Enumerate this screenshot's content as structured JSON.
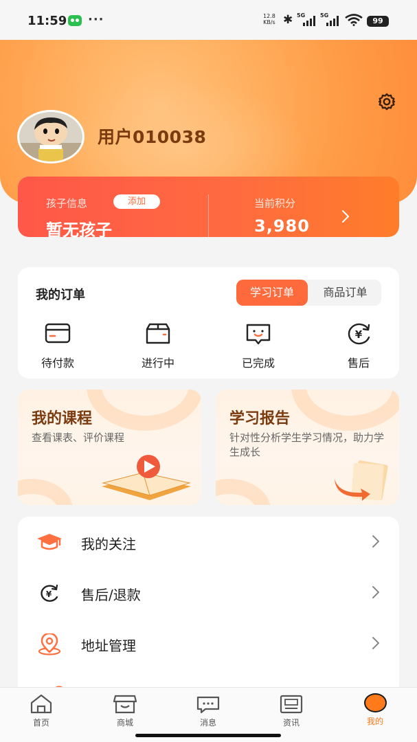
{
  "status_bar": {
    "time": "11:59",
    "dots": "···",
    "speed_value": "12.8",
    "speed_unit": "KB/s",
    "net1": "5G",
    "net2": "5G",
    "battery": "99"
  },
  "header": {
    "username": "用户010038"
  },
  "info_card": {
    "child_label": "孩子信息",
    "add_label": "添加",
    "child_value": "暂无孩子",
    "points_label": "当前积分",
    "points_value": "3,980"
  },
  "orders": {
    "title": "我的订单",
    "tabs": [
      {
        "label": "学习订单",
        "active": true
      },
      {
        "label": "商品订单",
        "active": false
      }
    ],
    "items": [
      {
        "label": "待付款",
        "icon": "wallet-icon"
      },
      {
        "label": "进行中",
        "icon": "package-icon"
      },
      {
        "label": "已完成",
        "icon": "smile-chat-icon"
      },
      {
        "label": "售后",
        "icon": "yen-refresh-icon"
      }
    ]
  },
  "features": [
    {
      "title": "我的课程",
      "desc": "查看课表、评价课程",
      "icon": "book-play-icon"
    },
    {
      "title": "学习报告",
      "desc": "针对性分析学生学习情况，助力学生成长",
      "icon": "report-arrow-icon"
    }
  ],
  "menu": [
    {
      "label": "我的关注",
      "icon": "graduation-cap-icon"
    },
    {
      "label": "售后/退款",
      "icon": "yen-icon"
    },
    {
      "label": "地址管理",
      "icon": "location-pin-icon"
    }
  ],
  "tabbar": [
    {
      "label": "首页",
      "icon": "home-icon",
      "active": false
    },
    {
      "label": "商城",
      "icon": "store-icon",
      "active": false
    },
    {
      "label": "消息",
      "icon": "message-icon",
      "active": false
    },
    {
      "label": "资讯",
      "icon": "news-icon",
      "active": false
    },
    {
      "label": "我的",
      "icon": "profile-dot-icon",
      "active": true
    }
  ],
  "colors": {
    "accent": "#ff6a3c",
    "tab_active": "#ff7a1a",
    "title_brown": "#7a3b10"
  }
}
